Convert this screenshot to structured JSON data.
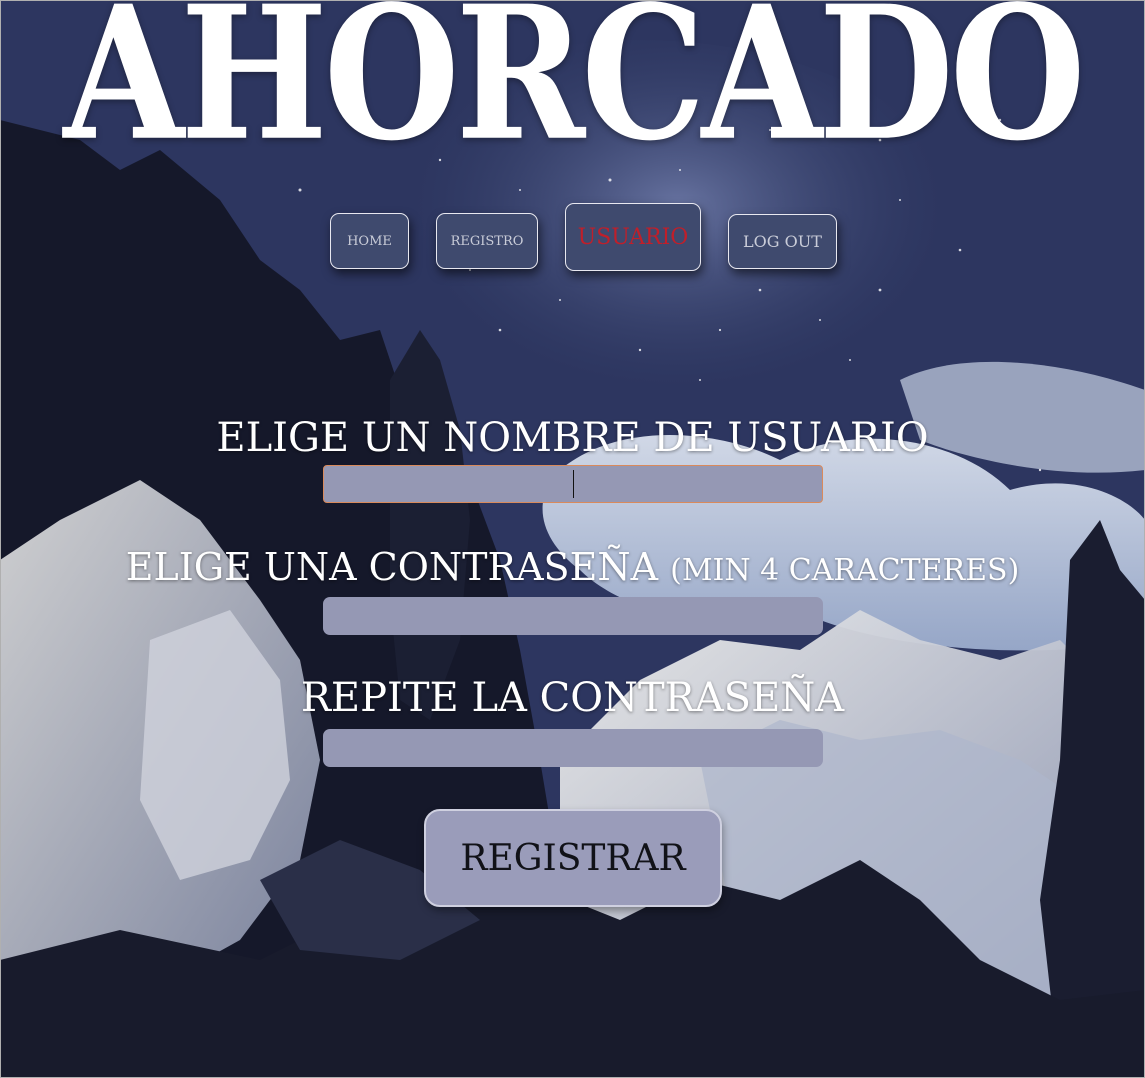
{
  "header": {
    "title": "AHORCADO"
  },
  "nav": {
    "home": "HOME",
    "registro": "REGISTRO",
    "usuario": "USUARIO",
    "logout": "LOG OUT",
    "active_color": "#c01f2a",
    "button_color": "#3f4a6e"
  },
  "form": {
    "username_label": "ELIGE UN NOMBRE DE USUARIO",
    "username_value": "",
    "password_label": "ELIGE UNA CONTRASEÑA",
    "password_hint": "(MIN 4 CARACTERES)",
    "password_value": "",
    "repeat_label": "REPITE LA CONTRASEÑA",
    "repeat_value": "",
    "submit_label": "REGISTRAR",
    "field_color": "#9598b4",
    "focus_border_color": "#d98a5c"
  }
}
